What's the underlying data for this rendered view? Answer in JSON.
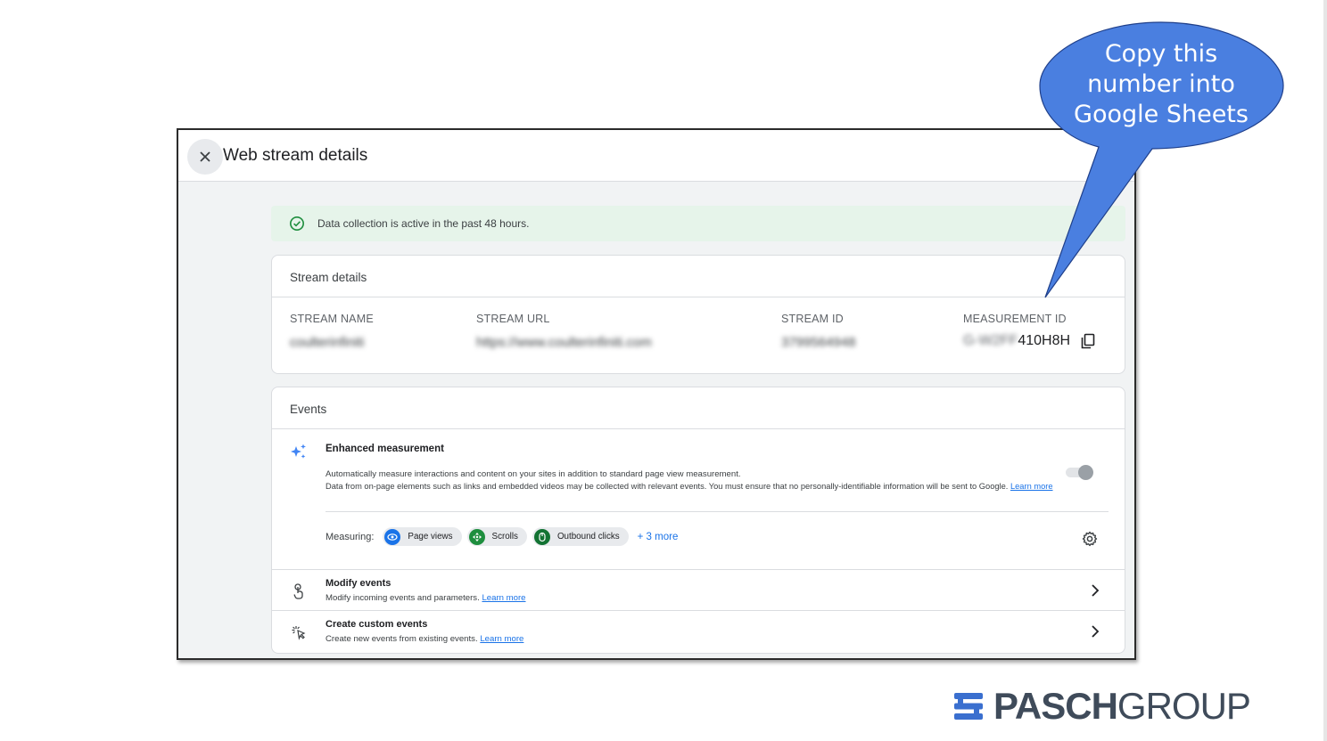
{
  "dialog": {
    "title": "Web stream details",
    "close_icon": "close-icon"
  },
  "banner": {
    "text": "Data collection is active in the past 48 hours.",
    "icon": "check-circle-icon",
    "color": "#e6f4ea"
  },
  "stream_details": {
    "heading": "Stream details",
    "stream_name_label": "STREAM NAME",
    "stream_name_value": "coulterinfiniti",
    "stream_url_label": "STREAM URL",
    "stream_url_value": "https://www.coulterinfiniti.com",
    "stream_id_label": "STREAM ID",
    "stream_id_value": "3799564948",
    "measurement_id_label": "MEASUREMENT ID",
    "measurement_id_hidden": "G-W2FF",
    "measurement_id_visible": "410H8H",
    "copy_icon": "copy-icon"
  },
  "events": {
    "heading": "Events",
    "enhanced": {
      "title": "Enhanced measurement",
      "desc1": "Automatically measure interactions and content on your sites in addition to standard page view measurement.",
      "desc2": "Data from on-page elements such as links and embedded videos may be collected with relevant events. You must ensure that no personally-identifiable information will be sent to Google.",
      "learn_more": "Learn more",
      "toggle_on": true
    },
    "measuring": {
      "label": "Measuring:",
      "chips": [
        "Page views",
        "Scrolls",
        "Outbound clicks"
      ],
      "more": "+ 3 more"
    },
    "modify": {
      "title": "Modify events",
      "desc": "Modify incoming events and parameters.",
      "learn_more": "Learn more"
    },
    "create": {
      "title": "Create custom events",
      "desc": "Create new events from existing events.",
      "learn_more": "Learn more"
    }
  },
  "callout": {
    "line1": "Copy this",
    "line2": "number into",
    "line3": "Google Sheets",
    "color": "#4a7fe0"
  },
  "logo": {
    "bold": "PASCH",
    "light": "GROUP"
  }
}
